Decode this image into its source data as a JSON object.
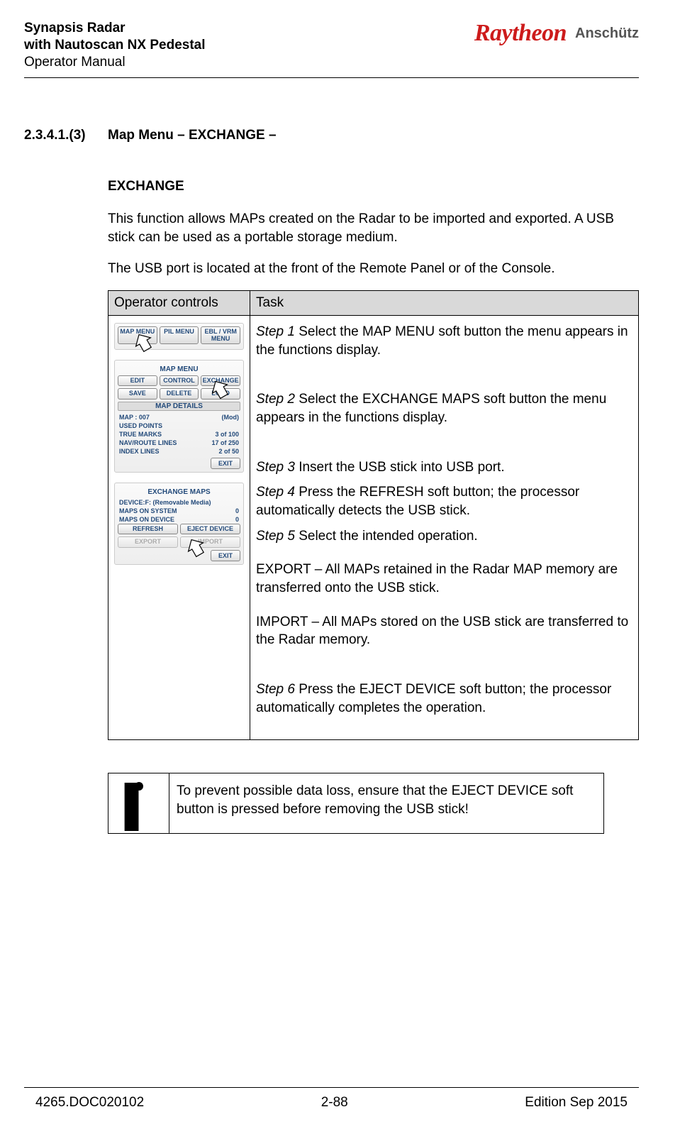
{
  "header": {
    "line1": "Synapsis Radar",
    "line2": "with Nautoscan NX Pedestal",
    "line3": "Operator Manual",
    "brand1": "Raytheon",
    "brand2": "Anschütz"
  },
  "section": {
    "number": "2.3.4.1.(3)",
    "title": "Map Menu – EXCHANGE –"
  },
  "exchange": {
    "heading": "EXCHANGE",
    "p1": "This function allows MAPs created on the Radar to be imported and exported. A USB stick can be used as a portable storage medium.",
    "p2": "The USB port is located at the front of the Remote Panel or of the Console."
  },
  "table": {
    "h1": "Operator controls",
    "h2": "Task"
  },
  "steps": {
    "s1a": "Step 1",
    "s1b": " Select the MAP MENU soft button the menu appears in the functions display.",
    "s2a": "Step 2",
    "s2b": " Select the EXCHANGE MAPS soft button the menu appears in the functions display.",
    "s3a": "Step 3",
    "s3b": " Insert the USB stick into USB port.",
    "s4a": "Step 4",
    "s4b": " Press the REFRESH soft button; the processor automatically  detects the USB stick.",
    "s5a": "Step 5",
    "s5b": " Select the intended operation.",
    "export": "EXPORT – All MAPs retained in the Radar MAP memory are transferred onto the USB stick.",
    "import": "IMPORT – All MAPs stored on the USB stick are transferred to the Radar memory.",
    "s6a": "Step 6",
    "s6b": " Press the EJECT DEVICE soft button; the processor automatically completes the operation."
  },
  "panel1": {
    "b1": "MAP MENU",
    "b2": "PIL MENU",
    "b3": "EBL / VRM MENU"
  },
  "panel2": {
    "title": "MAP MENU",
    "b1": "EDIT",
    "b2": "CONTROL",
    "b3": "EXCHANGE",
    "b4": "SAVE",
    "b5": "DELETE",
    "b6": "LOAD",
    "details": "MAP DETAILS",
    "r1a": "MAP : 007",
    "r1b": "(Mod)",
    "r2a": "USED POINTS",
    "r2b": "",
    "r3a": "TRUE MARKS",
    "r3b": "3  of   100",
    "r4a": "NAV/ROUTE LINES",
    "r4b": "17  of   250",
    "r5a": "INDEX LINES",
    "r5b": "2  of    50",
    "exit": "EXIT"
  },
  "panel3": {
    "title": "EXCHANGE MAPS",
    "r1a": "DEVICE:F: (Removable Media)",
    "r2a": "MAPS ON SYSTEM",
    "r2b": "0",
    "r3a": "MAPS ON DEVICE",
    "r3b": "0",
    "b1": "REFRESH",
    "b2": "EJECT DEVICE",
    "b3": "EXPORT",
    "b4": "IMPORT",
    "exit": "EXIT"
  },
  "note": {
    "text": "To prevent possible data loss, ensure that the EJECT DEVICE soft button is pressed before removing the USB stick!"
  },
  "footer": {
    "left": "4265.DOC020102",
    "center": "2-88",
    "right": "Edition Sep 2015"
  }
}
